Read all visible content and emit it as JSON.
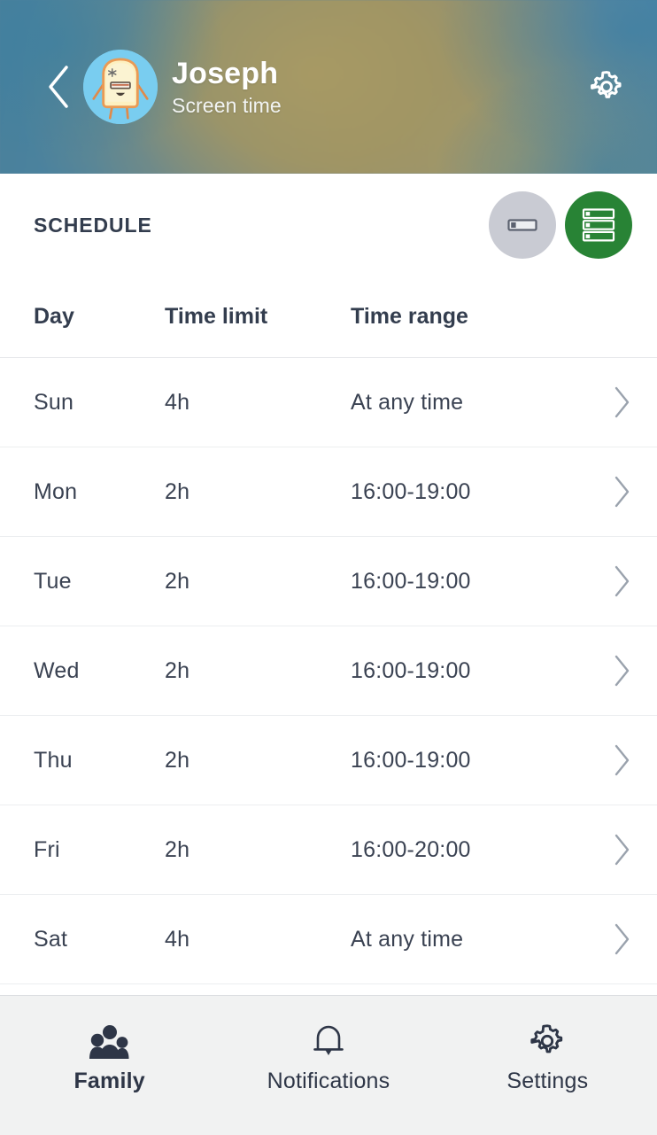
{
  "header": {
    "back_icon": "chevron-left-icon",
    "avatar_icon": "toast-character-avatar",
    "name": "Joseph",
    "subtitle": "Screen time",
    "settings_icon": "gear-icon",
    "gradient_colors": [
      "#49809b",
      "#97916f",
      "#4b86a8"
    ]
  },
  "schedule": {
    "section_title": "SCHEDULE",
    "mode_buttons": [
      {
        "icon": "slider-bar-icon",
        "active": false,
        "color": "#c9cbd3"
      },
      {
        "icon": "list-rows-icon",
        "active": true,
        "color": "#288335"
      }
    ],
    "columns": {
      "day": "Day",
      "time_limit": "Time limit",
      "time_range": "Time range"
    },
    "rows": [
      {
        "day": "Sun",
        "time_limit": "4h",
        "time_range": "At any time",
        "chevron": "chevron-right-icon"
      },
      {
        "day": "Mon",
        "time_limit": "2h",
        "time_range": "16:00-19:00",
        "chevron": "chevron-right-icon"
      },
      {
        "day": "Tue",
        "time_limit": "2h",
        "time_range": "16:00-19:00",
        "chevron": "chevron-right-icon"
      },
      {
        "day": "Wed",
        "time_limit": "2h",
        "time_range": "16:00-19:00",
        "chevron": "chevron-right-icon"
      },
      {
        "day": "Thu",
        "time_limit": "2h",
        "time_range": "16:00-19:00",
        "chevron": "chevron-right-icon"
      },
      {
        "day": "Fri",
        "time_limit": "2h",
        "time_range": "16:00-20:00",
        "chevron": "chevron-right-icon"
      },
      {
        "day": "Sat",
        "time_limit": "4h",
        "time_range": "At any time",
        "chevron": "chevron-right-icon"
      }
    ]
  },
  "bottom_nav": {
    "items": [
      {
        "label": "Family",
        "icon": "family-group-icon",
        "active": true
      },
      {
        "label": "Notifications",
        "icon": "bell-icon",
        "active": false
      },
      {
        "label": "Settings",
        "icon": "gear-icon",
        "active": false
      }
    ]
  }
}
